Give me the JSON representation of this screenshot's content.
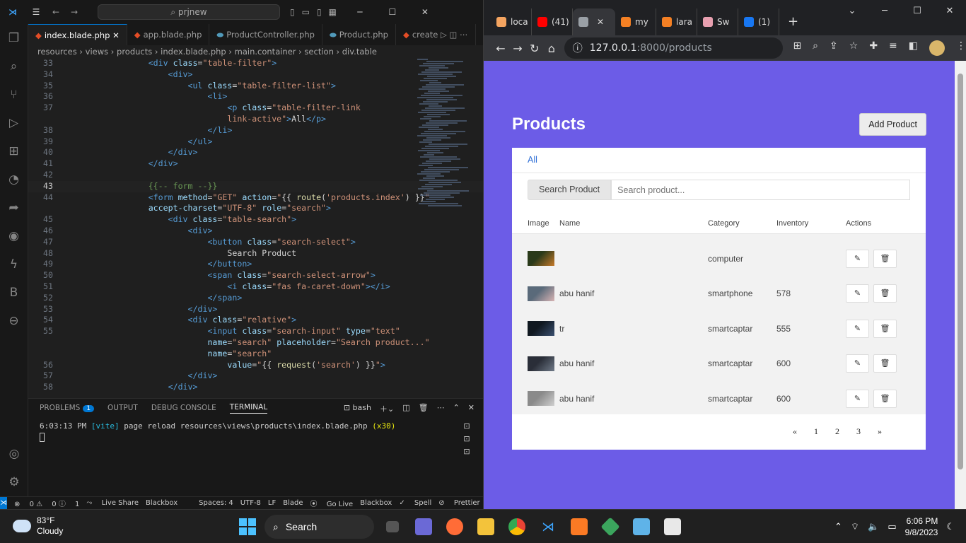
{
  "vscode": {
    "search_text": "prjnew",
    "tabs": [
      {
        "label": "index.blade.php",
        "close": "✕"
      },
      {
        "label": "app.blade.php"
      },
      {
        "label": "ProductController.php"
      },
      {
        "label": "Product.php"
      },
      {
        "label": "create"
      }
    ],
    "breadcrumbs": "resources › views › products › index.blade.php › main.container › section › div.table",
    "lines": [
      {
        "n": "33",
        "html": "<span class='tg'>&lt;div</span> <span class='at'>class</span>=<span class='st'>\"table-filter\"</span><span class='tg'>&gt;</span>",
        "ind": 4
      },
      {
        "n": "34",
        "html": "<span class='tg'>&lt;div&gt;</span>",
        "ind": 6
      },
      {
        "n": "35",
        "html": "<span class='tg'>&lt;ul</span> <span class='at'>class</span>=<span class='st'>\"table-filter-list\"</span><span class='tg'>&gt;</span>",
        "ind": 8
      },
      {
        "n": "36",
        "html": "<span class='tg'>&lt;li&gt;</span>",
        "ind": 10
      },
      {
        "n": "37",
        "html": "<span class='tg'>&lt;p</span> <span class='at'>class</span>=<span class='st'>\"table-filter-link</span>",
        "ind": 12
      },
      {
        "n": "",
        "html": "<span class='st'>link-active\"</span><span class='tg'>&gt;</span><span class='tx'>All</span><span class='tg'>&lt;/p&gt;</span>",
        "ind": 12
      },
      {
        "n": "38",
        "html": "<span class='tg'>&lt;/li&gt;</span>",
        "ind": 10
      },
      {
        "n": "39",
        "html": "<span class='tg'>&lt;/ul&gt;</span>",
        "ind": 8
      },
      {
        "n": "40",
        "html": "<span class='tg'>&lt;/div&gt;</span>",
        "ind": 6
      },
      {
        "n": "41",
        "html": "<span class='tg'>&lt;/div&gt;</span>",
        "ind": 4
      },
      {
        "n": "42",
        "html": "",
        "ind": 0
      },
      {
        "n": "43",
        "html": "<span class='cm'>{{-- form --}}</span>",
        "ind": 4,
        "cur": true
      },
      {
        "n": "44",
        "html": "<span class='tg'>&lt;form</span> <span class='at'>method</span>=<span class='st'>\"GET\"</span> <span class='at'>action</span>=<span class='st'>\"</span><span class='tx'>{{ </span><span class='ky'>route</span><span class='tx'>(</span><span class='st'>'products.index'</span><span class='tx'>) }}</span><span class='st'>\"</span>",
        "ind": 4
      },
      {
        "n": "",
        "html": "<span class='at'>accept-charset</span>=<span class='st'>\"UTF-8\"</span> <span class='at'>role</span>=<span class='st'>\"search\"</span><span class='tg'>&gt;</span>",
        "ind": 4
      },
      {
        "n": "45",
        "html": "<span class='tg'>&lt;div</span> <span class='at'>class</span>=<span class='st'>\"table-search\"</span><span class='tg'>&gt;</span>",
        "ind": 6
      },
      {
        "n": "46",
        "html": "<span class='tg'>&lt;div&gt;</span>",
        "ind": 8
      },
      {
        "n": "47",
        "html": "<span class='tg'>&lt;button</span> <span class='at'>class</span>=<span class='st'>\"search-select\"</span><span class='tg'>&gt;</span>",
        "ind": 10
      },
      {
        "n": "48",
        "html": "<span class='tx'>Search Product</span>",
        "ind": 12
      },
      {
        "n": "49",
        "html": "<span class='tg'>&lt;/button&gt;</span>",
        "ind": 10
      },
      {
        "n": "50",
        "html": "<span class='tg'>&lt;span</span> <span class='at'>class</span>=<span class='st'>\"search-select-arrow\"</span><span class='tg'>&gt;</span>",
        "ind": 10
      },
      {
        "n": "51",
        "html": "<span class='tg'>&lt;i</span> <span class='at'>class</span>=<span class='st'>\"fas fa-caret-down\"</span><span class='tg'>&gt;&lt;/i&gt;</span>",
        "ind": 12
      },
      {
        "n": "52",
        "html": "<span class='tg'>&lt;/span&gt;</span>",
        "ind": 10
      },
      {
        "n": "53",
        "html": "<span class='tg'>&lt;/div&gt;</span>",
        "ind": 8
      },
      {
        "n": "54",
        "html": "<span class='tg'>&lt;div</span> <span class='at'>class</span>=<span class='st'>\"relative\"</span><span class='tg'>&gt;</span>",
        "ind": 8
      },
      {
        "n": "55",
        "html": "<span class='tg'>&lt;input</span> <span class='at'>class</span>=<span class='st'>\"search-input\"</span> <span class='at'>type</span>=<span class='st'>\"text\"</span>",
        "ind": 10
      },
      {
        "n": "",
        "html": "<span class='at'>name</span>=<span class='st'>\"search\"</span> <span class='at'>placeholder</span>=<span class='st'>\"Search product...\"</span>",
        "ind": 10
      },
      {
        "n": "",
        "html": "<span class='at'>name</span>=<span class='st'>\"search\"</span>",
        "ind": 10
      },
      {
        "n": "56",
        "html": "<span class='at'>value</span>=<span class='st'>\"</span><span class='tx'>{{ </span><span class='ky'>request</span><span class='tx'>(</span><span class='st'>'search'</span><span class='tx'>) }}</span><span class='st'>\"</span><span class='tg'>&gt;</span>",
        "ind": 12
      },
      {
        "n": "57",
        "html": "<span class='tg'>&lt;/div&gt;</span>",
        "ind": 8
      },
      {
        "n": "58",
        "html": "<span class='tg'>&lt;/div&gt;</span>",
        "ind": 6
      }
    ],
    "panel_tabs": {
      "problems": "PROBLEMS",
      "problems_count": "1",
      "output": "OUTPUT",
      "debug": "DEBUG CONSOLE",
      "terminal": "TERMINAL",
      "shell": "bash"
    },
    "terminal": {
      "time": "6:03:13 PM",
      "tag": "[vite]",
      "msg": "page reload resources\\views\\products\\index.blade.php",
      "count": "(x30)"
    },
    "status": {
      "errors": "0",
      "warnings": "0",
      "info": "1",
      "live_share": "Live Share",
      "blackbox": "Blackbox",
      "spaces": "Spaces: 4",
      "encoding": "UTF-8",
      "eol": "LF",
      "lang": "Blade",
      "golive": "Go Live",
      "blackbox2": "Blackbox",
      "spell": "Spell",
      "prettier": "Prettier"
    }
  },
  "browser": {
    "tabs": [
      {
        "label": "loca",
        "color": "#f4a460"
      },
      {
        "label": "(41)",
        "color": "#ff0000"
      },
      {
        "label": "",
        "color": "#9aa0a6"
      },
      {
        "label": "my",
        "color": "#f48024"
      },
      {
        "label": "lara",
        "color": "#f48024"
      },
      {
        "label": "Sw",
        "color": "#e8a0b0"
      },
      {
        "label": "(1)",
        "color": "#1877f2"
      }
    ],
    "url_host": "127.0.0.1",
    "url_rest": ":8000/products"
  },
  "page": {
    "title": "Products",
    "add_button": "Add Product",
    "filter_all": "All",
    "search_button": "Search Product",
    "search_placeholder": "Search product...",
    "columns": [
      "Image",
      "Name",
      "Category",
      "Inventory",
      "Actions"
    ],
    "rows": [
      {
        "name": "",
        "category": "computer",
        "inventory": "",
        "img": [
          "#2a3a1a",
          "#c77a2a"
        ]
      },
      {
        "name": "abu hanif",
        "category": "smartphone",
        "inventory": "578",
        "img": [
          "#5a6a7a",
          "#d8b4b4"
        ]
      },
      {
        "name": "tr",
        "category": "smartcaptar",
        "inventory": "555",
        "img": [
          "#101820",
          "#3a5070"
        ]
      },
      {
        "name": "abu hanif",
        "category": "smartcaptar",
        "inventory": "600",
        "img": [
          "#2a2e38",
          "#707a88"
        ]
      },
      {
        "name": "abu hanif",
        "category": "smartcaptar",
        "inventory": "600",
        "img": [
          "#8a8a8a",
          "#d0d0d0"
        ]
      }
    ],
    "pagination": [
      "«",
      "1",
      "2",
      "3",
      "»"
    ]
  },
  "taskbar": {
    "temp": "83°F",
    "condition": "Cloudy",
    "search": "Search",
    "time": "6:06 PM",
    "date": "9/8/2023"
  }
}
